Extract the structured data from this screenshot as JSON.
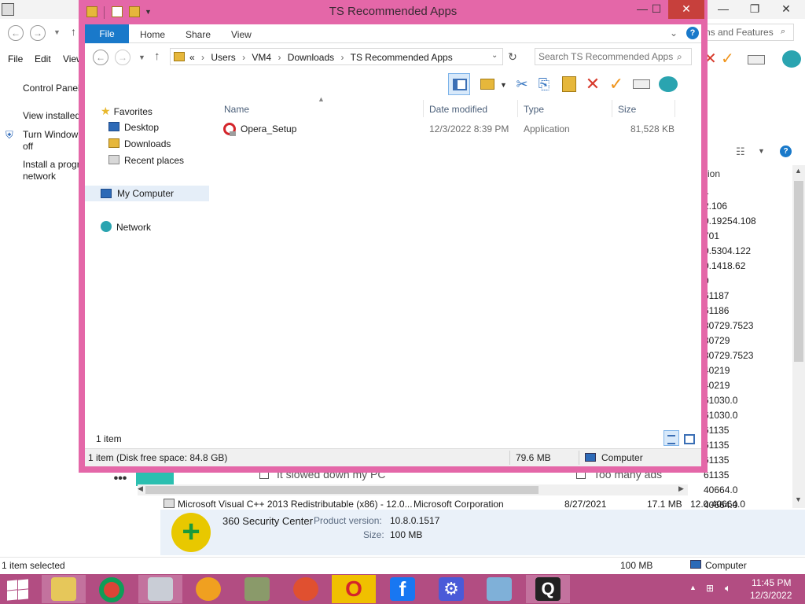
{
  "background_window": {
    "menu": [
      "File",
      "Edit",
      "View"
    ],
    "search_placeholder": "ns and Features",
    "left_links": [
      "Control Panel",
      "View installed",
      "Turn Window",
      "off",
      "Install a progr",
      "network"
    ],
    "column_header": "ion",
    "versions": [
      "1",
      "2.106",
      "0.19254.108",
      "701",
      "0.5304.122",
      "0.1418.62",
      "0",
      "61187",
      "61186",
      "30729.7523",
      "30729",
      "30729.7523",
      "40219",
      "40219",
      "61030.0",
      "61030.0",
      "61135",
      "61135",
      "61135",
      "61135",
      "40664.0",
      "40664.0"
    ],
    "checkboxes": [
      "It slowed down my PC",
      "Too many ads"
    ],
    "row": {
      "name": "Microsoft Visual C++ 2013 Redistributable (x86) - 12.0...",
      "publisher": "Microsoft Corporation",
      "date": "8/27/2021",
      "size": "17.1 MB",
      "version": "12.0.40664.0"
    },
    "detail": {
      "name": "360 Security Center",
      "product_version_label": "Product version:",
      "product_version": "10.8.0.1517",
      "size_label": "Size:",
      "size": "100 MB"
    },
    "status": {
      "left": "1 item selected",
      "size": "100 MB",
      "location": "Computer"
    }
  },
  "explorer": {
    "title": "TS Recommended Apps",
    "ribbon_tabs": [
      "File",
      "Home",
      "Share",
      "View"
    ],
    "breadcrumb": [
      "«",
      "Users",
      "VM4",
      "Downloads",
      "TS Recommended Apps"
    ],
    "search_placeholder": "Search TS Recommended Apps",
    "nav": {
      "favorites": "Favorites",
      "desktop": "Desktop",
      "downloads": "Downloads",
      "recent": "Recent places",
      "computer": "My Computer",
      "network": "Network"
    },
    "columns": [
      "Name",
      "Date modified",
      "Type",
      "Size"
    ],
    "files": [
      {
        "name": "Opera_Setup",
        "date": "12/3/2022 8:39 PM",
        "type": "Application",
        "size": "81,528 KB"
      }
    ],
    "item_count": "1 item",
    "status": {
      "left": "1 item (Disk free space: 84.8 GB)",
      "size": "79.6 MB",
      "location": "Computer"
    }
  },
  "taskbar": {
    "time": "11:45 PM",
    "date": "12/3/2022"
  },
  "colors": {
    "window_frame": "#e467a8",
    "taskbar": "#b24d82",
    "ribbon_file": "#1979ca"
  }
}
